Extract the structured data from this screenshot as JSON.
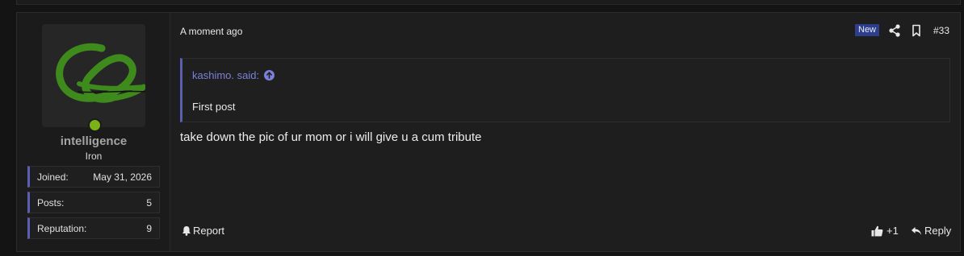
{
  "post": {
    "timestamp": "A moment ago",
    "badge": "New",
    "number": "#33",
    "quote": {
      "author": "kashimo. said:",
      "text": "First post"
    },
    "message": "take down the pic of ur mom or i will give u a cum tribute",
    "actions": {
      "report": "Report",
      "like_count": "+1",
      "reply": "Reply"
    }
  },
  "user": {
    "name": "intelligence",
    "title": "Iron",
    "status": "online",
    "stats": [
      {
        "label": "Joined:",
        "value": "May 31, 2026"
      },
      {
        "label": "Posts:",
        "value": "5"
      },
      {
        "label": "Reputation:",
        "value": "9"
      }
    ]
  },
  "icons": [
    "share-icon",
    "bookmark-icon",
    "quote-arrow-icon",
    "bell-icon",
    "thumbs-up-icon",
    "reply-arrow-icon"
  ],
  "colors": {
    "accent": "#5b5fb0",
    "quote_link": "#7b80d8",
    "online": "#7ab317",
    "badge_bg": "#2d3e8a"
  }
}
